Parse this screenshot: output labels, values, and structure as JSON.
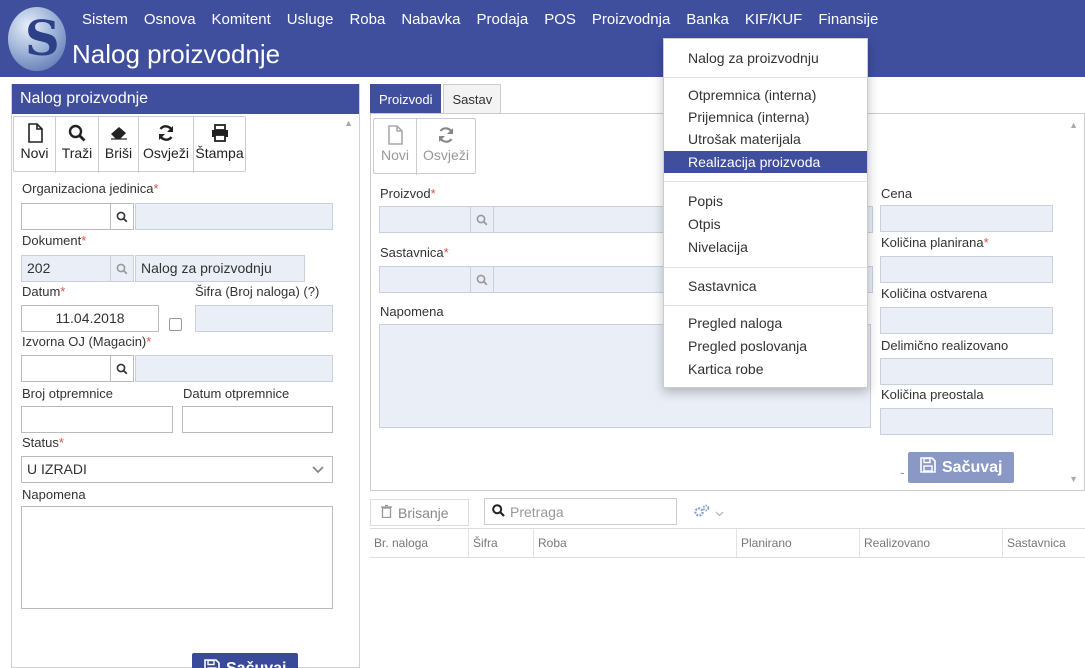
{
  "header": {
    "app_title": "Nalog proizvodnje",
    "menu": [
      "Sistem",
      "Osnova",
      "Komitent",
      "Usluge",
      "Roba",
      "Nabavka",
      "Prodaja",
      "POS",
      "Proizvodnja",
      "Banka",
      "KIF/KUF",
      "Finansije"
    ],
    "active_menu": "Proizvodnja",
    "logo_letter": "S"
  },
  "left_panel": {
    "title": "Nalog proizvodnje",
    "toolbar": [
      {
        "label": "Novi",
        "icon": "file-icon"
      },
      {
        "label": "Traži",
        "icon": "search-icon"
      },
      {
        "label": "Briši",
        "icon": "eraser-icon"
      },
      {
        "label": "Osvježi",
        "icon": "refresh-icon"
      },
      {
        "label": "Štampa",
        "icon": "print-icon"
      }
    ],
    "org_unit_label": "Organizaciona jedinica",
    "document_label": "Dokument",
    "document_code": "202",
    "document_name": "Nalog za proizvodnju",
    "date_label": "Datum",
    "date_value": "11.04.2018",
    "sifra_label": "Šifra (Broj naloga) (?)",
    "source_unit_label": "Izvorna OJ (Magacin)",
    "dispatch_no_label": "Broj otpremnice",
    "dispatch_date_label": "Datum otpremnice",
    "status_label": "Status",
    "status_value": "U IZRADI",
    "note_label": "Napomena",
    "save_label": "Sačuvaj",
    "save_dash": "-"
  },
  "center_panel": {
    "tabs": [
      {
        "label": "Proizvodi",
        "active": true
      },
      {
        "label": "Sastav",
        "active": false
      }
    ],
    "toolbar": [
      {
        "label": "Novi",
        "icon": "file-icon"
      },
      {
        "label": "Osvježi",
        "icon": "refresh-icon"
      }
    ],
    "product_label": "Proizvod",
    "bom_label": "Sastavnica",
    "note_label": "Napomena",
    "price_label": "Cena",
    "qty_planned_label": "Količina planirana",
    "qty_realized_label": "Količina ostvarena",
    "partially_realized_label": "Delimično realizovano",
    "qty_remaining_label": "Količina preostala",
    "save_label": "Sačuvaj",
    "save_dash": "-"
  },
  "grid": {
    "delete_label": "Brisanje",
    "search_placeholder": "Pretraga",
    "columns": [
      "Br. naloga",
      "Šifra",
      "Roba",
      "Planirano",
      "Realizovano",
      "Sastavnica"
    ]
  },
  "dropdown": {
    "groups": [
      [
        "Nalog za proizvodnju"
      ],
      [
        "Otpremnica (interna)",
        "Prijemnica (interna)",
        "Utrošak materijala",
        "Realizacija proizvoda"
      ],
      [
        "Popis",
        "Otpis",
        "Nivelacija"
      ],
      [
        "Sastavnica"
      ],
      [
        "Pregled naloga",
        "Pregled poslovanja",
        "Kartica robe"
      ]
    ],
    "highlighted": "Realizacija proizvoda"
  },
  "colors": {
    "primary": "#3f4f9e",
    "readonly_bg": "#e9eef7",
    "required": "#d9534f"
  }
}
